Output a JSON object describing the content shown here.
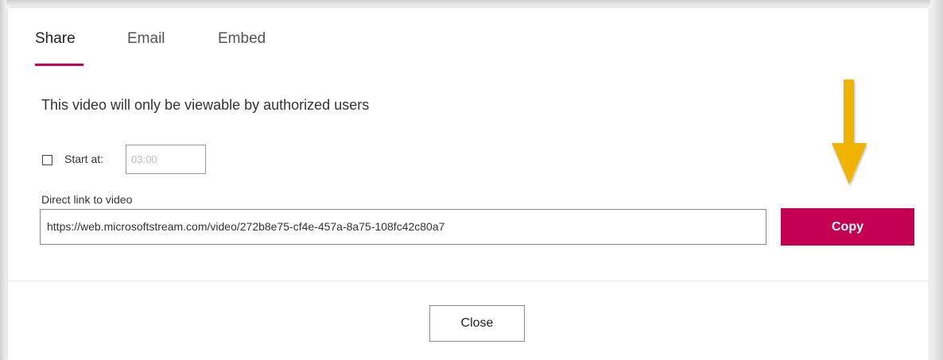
{
  "tabs": [
    {
      "label": "Share",
      "active": true
    },
    {
      "label": "Email",
      "active": false
    },
    {
      "label": "Embed",
      "active": false
    }
  ],
  "info_text": "This video will only be viewable by authorized users",
  "start_at": {
    "label": "Start at:",
    "checked": false,
    "value": "03:00"
  },
  "direct_link": {
    "label": "Direct link to video",
    "value": "https://web.microsoftstream.com/video/272b8e75-cf4e-457a-8a75-108fc42c80a7"
  },
  "copy_label": "Copy",
  "close_label": "Close",
  "colors": {
    "accent": "#c30052",
    "arrow": "#f0b400"
  },
  "icons": {
    "annotation": "down-arrow-icon"
  }
}
